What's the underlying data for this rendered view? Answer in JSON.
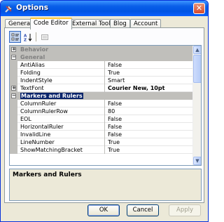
{
  "window": {
    "title": "Options",
    "close_label": "✕"
  },
  "tabs": [
    {
      "label": "General",
      "active": false
    },
    {
      "label": "Code Editor",
      "active": true
    },
    {
      "label": "External Tools",
      "active": false
    },
    {
      "label": "Blog",
      "active": false
    },
    {
      "label": "Account",
      "active": false
    }
  ],
  "toolbar": {
    "categorized_icon": "categorized-view-icon",
    "alphabetical_icon": "alphabetical-sort-icon",
    "property_pages_icon": "property-pages-icon"
  },
  "grid": {
    "rows": [
      {
        "type": "cat",
        "expander": "+",
        "name": "Behavior",
        "selected": false
      },
      {
        "type": "cat",
        "expander": "−",
        "name": "General",
        "selected": false
      },
      {
        "type": "prop",
        "name": "AntiAlias",
        "value": "False"
      },
      {
        "type": "prop",
        "name": "Folding",
        "value": "True"
      },
      {
        "type": "prop",
        "name": "IndentStyle",
        "value": "Smart"
      },
      {
        "type": "prop",
        "expander": "+",
        "name": "TextFont",
        "value": "Courier New, 10pt",
        "bold": true
      },
      {
        "type": "cat",
        "expander": "−",
        "name": "Markers and Rulers",
        "selected": true
      },
      {
        "type": "prop",
        "name": "ColumnRuler",
        "value": "False"
      },
      {
        "type": "prop",
        "name": "ColumnRulerRow",
        "value": "80"
      },
      {
        "type": "prop",
        "name": "EOL",
        "value": "False"
      },
      {
        "type": "prop",
        "name": "HorizontalRuler",
        "value": "False"
      },
      {
        "type": "prop",
        "name": "InvalidLine",
        "value": "False"
      },
      {
        "type": "prop",
        "name": "LineNumber",
        "value": "True"
      },
      {
        "type": "prop",
        "name": "ShowMatchingBracket",
        "value": "True"
      }
    ]
  },
  "help": {
    "title": "Markers and Rulers",
    "description": ""
  },
  "buttons": {
    "ok": "OK",
    "cancel": "Cancel",
    "apply": "Apply"
  },
  "colors": {
    "title_bar": "#0054e3",
    "category_bg": "#c0bfbb",
    "selection": "#0a246a",
    "active_tab_accent": "#ffc83c"
  }
}
